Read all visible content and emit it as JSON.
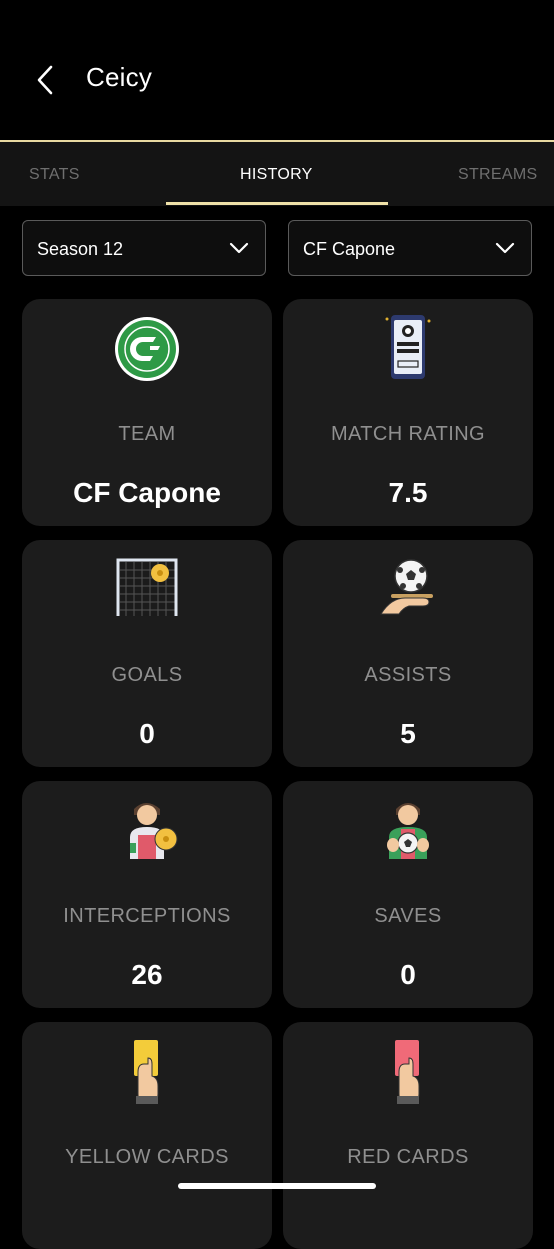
{
  "header": {
    "title": "Ceicy"
  },
  "tabs": [
    {
      "label": "STATS",
      "active": false
    },
    {
      "label": "HISTORY",
      "active": true
    },
    {
      "label": "STREAMS",
      "active": false
    }
  ],
  "filters": {
    "season": "Season 12",
    "team": "CF Capone"
  },
  "colors": {
    "accent": "#efe1a8",
    "card_bg": "#1c1c1c"
  },
  "cards": [
    {
      "icon": "team-crest-icon",
      "label": "TEAM",
      "value": "CF Capone"
    },
    {
      "icon": "match-rating-phone-icon",
      "label": "MATCH RATING",
      "value": "7.5"
    },
    {
      "icon": "goal-net-icon",
      "label": "GOALS",
      "value": "0"
    },
    {
      "icon": "ball-on-hand-icon",
      "label": "ASSISTS",
      "value": "5"
    },
    {
      "icon": "player-with-ball-icon",
      "label": "INTERCEPTIONS",
      "value": "26"
    },
    {
      "icon": "goalkeeper-icon",
      "label": "SAVES",
      "value": "0"
    },
    {
      "icon": "yellow-card-icon",
      "label": "YELLOW CARDS",
      "value": ""
    },
    {
      "icon": "red-card-icon",
      "label": "RED CARDS",
      "value": ""
    }
  ]
}
